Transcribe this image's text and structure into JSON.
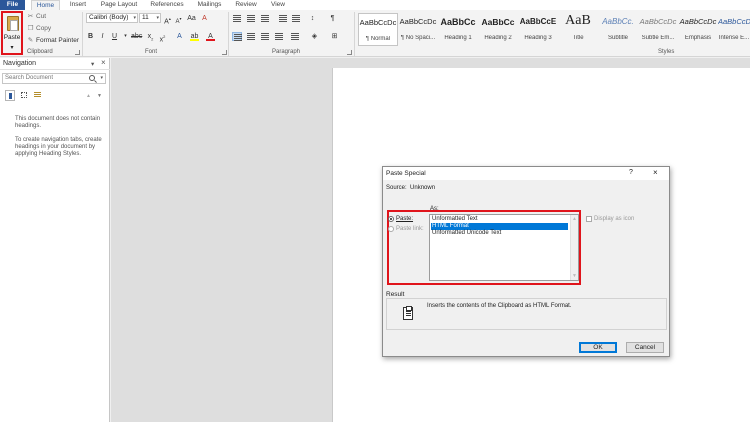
{
  "tabs": [
    "File",
    "Home",
    "Insert",
    "Page Layout",
    "References",
    "Mailings",
    "Review",
    "View"
  ],
  "active_tab": "Home",
  "clipboard": {
    "paste_label": "Paste",
    "paste_arrow": "▾",
    "cut_label": "Cut",
    "copy_label": "Copy",
    "format_painter_label": "Format Painter",
    "group_label": "Clipboard"
  },
  "font": {
    "family": "Calibri (Body)",
    "size": "11",
    "group_label": "Font"
  },
  "paragraph": {
    "group_label": "Paragraph"
  },
  "styles": {
    "group_label": "Styles",
    "items": [
      {
        "sample": "AaBbCcDc",
        "name": "¶ Normal"
      },
      {
        "sample": "AaBbCcDc",
        "name": "¶ No Spaci..."
      },
      {
        "sample": "AaBbCc",
        "name": "Heading 1"
      },
      {
        "sample": "AaBbCc",
        "name": "Heading 2"
      },
      {
        "sample": "AaBbCcE",
        "name": "Heading 3"
      },
      {
        "sample": "AaB",
        "name": "Title"
      },
      {
        "sample": "AaBbCc.",
        "name": "Subtitle"
      },
      {
        "sample": "AaBbCcDc",
        "name": "Subtle Em..."
      },
      {
        "sample": "AaBbCcDc",
        "name": "Emphasis"
      },
      {
        "sample": "AaBbCcDc",
        "name": "Intense E..."
      }
    ]
  },
  "navigation": {
    "title": "Navigation",
    "close": "×",
    "menu": "▾",
    "search_placeholder": "Search Document",
    "search_dropdown": "▾",
    "prev": "▲",
    "next": "▼",
    "msg1": "This document does not contain headings.",
    "msg2": "To create navigation tabs, create headings in your document by applying Heading Styles."
  },
  "dialog": {
    "title": "Paste Special",
    "help": "?",
    "close": "×",
    "source_label": "Source:",
    "source_value": "Unknown",
    "as_label": "As:",
    "paste_option": "Paste:",
    "paste_link_option": "Paste link:",
    "formats": [
      "Unformatted Text",
      "HTML Format",
      "Unformatted Unicode Text"
    ],
    "selected_format": "HTML Format",
    "display_as_icon": "Display as icon",
    "result_title": "Result",
    "result_text": "Inserts the contents of the Clipboard as HTML Format.",
    "ok_label": "OK",
    "cancel_label": "Cancel"
  },
  "colors": {
    "file_tab": "#2b579a",
    "highlight_box": "#e0141b",
    "selection": "#0078d7"
  }
}
